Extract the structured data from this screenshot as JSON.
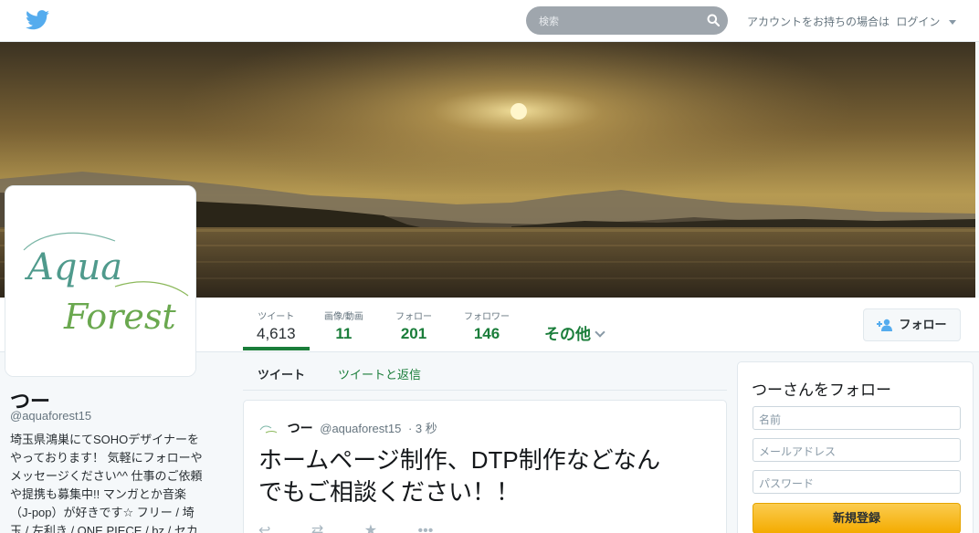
{
  "topbar": {
    "logo_icon": "bird-logo-icon",
    "search_placeholder": "検索",
    "login_text": "アカウントをお持ちの場合は",
    "login_link": "ログイン"
  },
  "nav": {
    "stats": [
      {
        "label": "ツイート",
        "value": "4,613"
      },
      {
        "label": "画像/動画",
        "value": "11"
      },
      {
        "label": "フォロー",
        "value": "201"
      },
      {
        "label": "フォロワー",
        "value": "146"
      }
    ],
    "more_label": "その他",
    "follow_label": "フォロー"
  },
  "avatar": {
    "line1": "Aqua",
    "line2": "Forest"
  },
  "profile": {
    "name": "つー",
    "handle": "@aquaforest15",
    "bio_lines": [
      "埼玉県鴻巣にてSOHOデザイナーを",
      "やっております！ 気軽にフォローや",
      "メッセージください^^ 仕事のご依頼",
      "や提携も募集中!! マンガとか音楽",
      "（J-pop）が好きです☆ フリー / 埼",
      "玉 / 左利き / ONE PIECE / bz / セカ"
    ]
  },
  "tabs": {
    "tweets": "ツイート",
    "replies": "ツイートと返信"
  },
  "tweet": {
    "name": "つー",
    "handle": "@aquaforest15",
    "time": "· 3 秒",
    "text_line1": "ホームページ制作、DTP制作などなん",
    "text_line2": "でもご相談ください！！"
  },
  "signup": {
    "title": "つーさんをフォロー",
    "name_placeholder": "名前",
    "email_placeholder": "メールアドレス",
    "password_placeholder": "パスワード",
    "button_label": "新規登録"
  },
  "colors": {
    "accent": "#1a7d3a",
    "button_yellow": "#f4ab00",
    "search_bg": "#9fa6ad"
  }
}
